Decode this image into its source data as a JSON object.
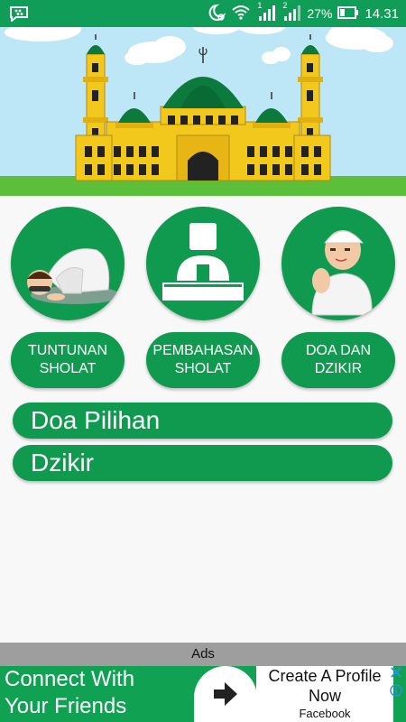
{
  "status_bar": {
    "notification_icon": "bbm-icon",
    "battery_percent": "27%",
    "time": "14.31",
    "sim1": "1",
    "sim2": "2"
  },
  "menu": {
    "circles": [
      {
        "icon": "prostrating-man-icon"
      },
      {
        "icon": "person-at-podium-icon"
      },
      {
        "icon": "praying-man-icon"
      }
    ],
    "buttons": [
      {
        "label": "TUNTUNAN\nSHOLAT"
      },
      {
        "label": "PEMBAHASAN\nSHOLAT"
      },
      {
        "label": "DOA DAN\nDZIKIR"
      }
    ],
    "bars": [
      {
        "label": "Doa Pilihan"
      },
      {
        "label": "Dzikir"
      }
    ]
  },
  "ads": {
    "label": "Ads",
    "headline_line1": "Connect With",
    "headline_line2": "Your Friends",
    "cta_line1": "Create A Profile",
    "cta_line2": "Now",
    "advertiser": "Facebook"
  },
  "colors": {
    "status_bar": "#0f9d58",
    "accent": "#109a4f",
    "sky": "#bde7f6",
    "mosque_yellow": "#f3c81c",
    "dome_green": "#0b7a3c"
  }
}
